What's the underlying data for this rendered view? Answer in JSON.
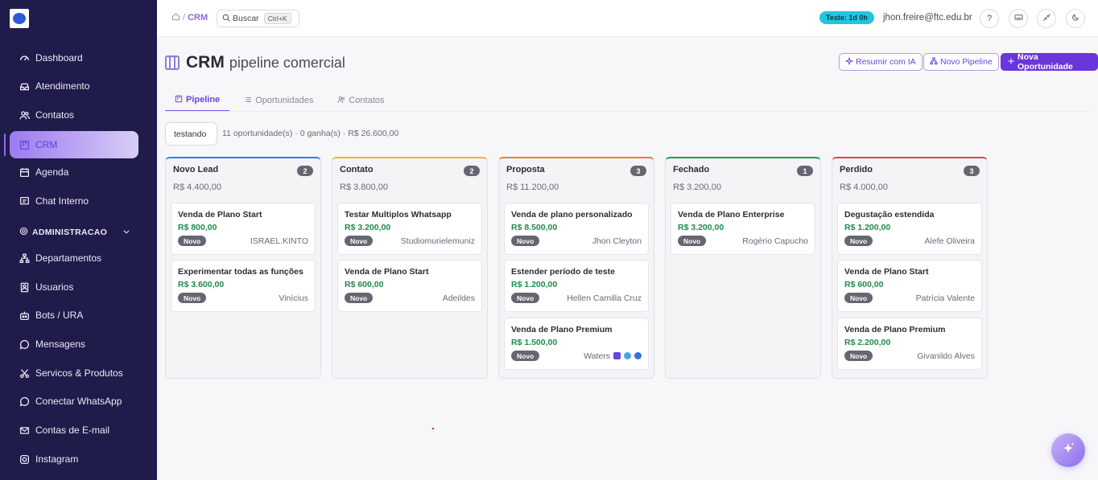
{
  "sidebar": {
    "items": [
      {
        "label": "Dashboard",
        "icon": "gauge-icon"
      },
      {
        "label": "Atendimento",
        "icon": "inbox-icon"
      },
      {
        "label": "Contatos",
        "icon": "users-icon"
      },
      {
        "label": "CRM",
        "icon": "kanban-icon",
        "active": true
      },
      {
        "label": "Agenda",
        "icon": "calendar-icon"
      },
      {
        "label": "Chat Interno",
        "icon": "chat-icon"
      }
    ],
    "section_label": "ADMINISTRACAO",
    "admin_items": [
      {
        "label": "Departamentos",
        "icon": "sitemap-icon"
      },
      {
        "label": "Usuarios",
        "icon": "user-icon"
      },
      {
        "label": "Bots / URA",
        "icon": "bot-icon"
      },
      {
        "label": "Mensagens",
        "icon": "message-icon"
      },
      {
        "label": "Servicos & Produtos",
        "icon": "scissors-icon"
      },
      {
        "label": "Conectar WhatsApp",
        "icon": "whatsapp-icon"
      },
      {
        "label": "Contas de E-mail",
        "icon": "mail-icon"
      },
      {
        "label": "Instagram",
        "icon": "instagram-icon"
      }
    ]
  },
  "topbar": {
    "breadcrumb_sep": "/",
    "breadcrumb_current": "CRM",
    "search_label": "Buscar",
    "search_shortcut": "Ctrl+K",
    "trial_badge": "Teste: 1d 0h",
    "user_email": "jhon.freire@ftc.edu.br",
    "help_label": "?"
  },
  "header": {
    "title": "CRM",
    "subtitle": "pipeline comercial",
    "btn_summarize": "Resumir com IA",
    "btn_new_pipeline": "Novo Pipeline",
    "btn_new_opportunity": "Nova Oportunidade"
  },
  "tabs": [
    {
      "label": "Pipeline",
      "active": true
    },
    {
      "label": "Oportunidades"
    },
    {
      "label": "Contatos"
    }
  ],
  "filter": {
    "pipeline_name": "testando",
    "summary": "11 oportunidade(s) · 0 ganha(s) · R$ 26.600,00"
  },
  "colors": {
    "accent": "#6a35db",
    "sidebar_bg": "#1f1b4a",
    "value_green": "#1f8a4c"
  },
  "columns": [
    {
      "name": "Novo Lead",
      "count": "2",
      "total": "R$ 4.400,00",
      "color": "#2f7fe0",
      "cards": [
        {
          "title": "Venda de Plano Start",
          "value": "R$ 800,00",
          "status": "Novo",
          "owner": "ISRAEL.KINTO"
        },
        {
          "title": "Experimentar todas as funções",
          "value": "R$ 3.600,00",
          "status": "Novo",
          "owner": "Vinícius"
        }
      ]
    },
    {
      "name": "Contato",
      "count": "2",
      "total": "R$ 3.800,00",
      "color": "#f0b429",
      "cards": [
        {
          "title": "Testar Multiplos Whatsapp",
          "value": "R$ 3.200,00",
          "status": "Novo",
          "owner": "Studiomurielemuniz"
        },
        {
          "title": "Venda de Plano Start",
          "value": "R$ 600,00",
          "status": "Novo",
          "owner": "Adeildes"
        }
      ]
    },
    {
      "name": "Proposta",
      "count": "3",
      "total": "R$ 11.200,00",
      "color": "#f07a2a",
      "cards": [
        {
          "title": "Venda de plano personalizado",
          "value": "R$ 8.500,00",
          "status": "Novo",
          "owner": "Jhon Cleyton"
        },
        {
          "title": "Estender período de teste",
          "value": "R$ 1.200,00",
          "status": "Novo",
          "owner": "Hellen Camilla Cruz"
        },
        {
          "title": "Venda de Plano Premium",
          "value": "R$ 1.500,00",
          "status": "Novo",
          "owner": "Waters"
        }
      ]
    },
    {
      "name": "Fechado",
      "count": "1",
      "total": "R$ 3.200,00",
      "color": "#1f9a55",
      "cards": [
        {
          "title": "Venda de Plano Enterprise",
          "value": "R$ 3.200,00",
          "status": "Novo",
          "owner": "Rogério Capucho"
        }
      ]
    },
    {
      "name": "Perdido",
      "count": "3",
      "total": "R$ 4.000,00",
      "color": "#e04050",
      "cards": [
        {
          "title": "Degustação estendida",
          "value": "R$ 1.200,00",
          "status": "Novo",
          "owner": "Alefe Oliveira"
        },
        {
          "title": "Venda de Plano Start",
          "value": "R$ 600,00",
          "status": "Novo",
          "owner": "Patrícia Valente"
        },
        {
          "title": "Venda de Plano Premium",
          "value": "R$ 2.200,00",
          "status": "Novo",
          "owner": "Givanildo Alves"
        }
      ]
    }
  ]
}
